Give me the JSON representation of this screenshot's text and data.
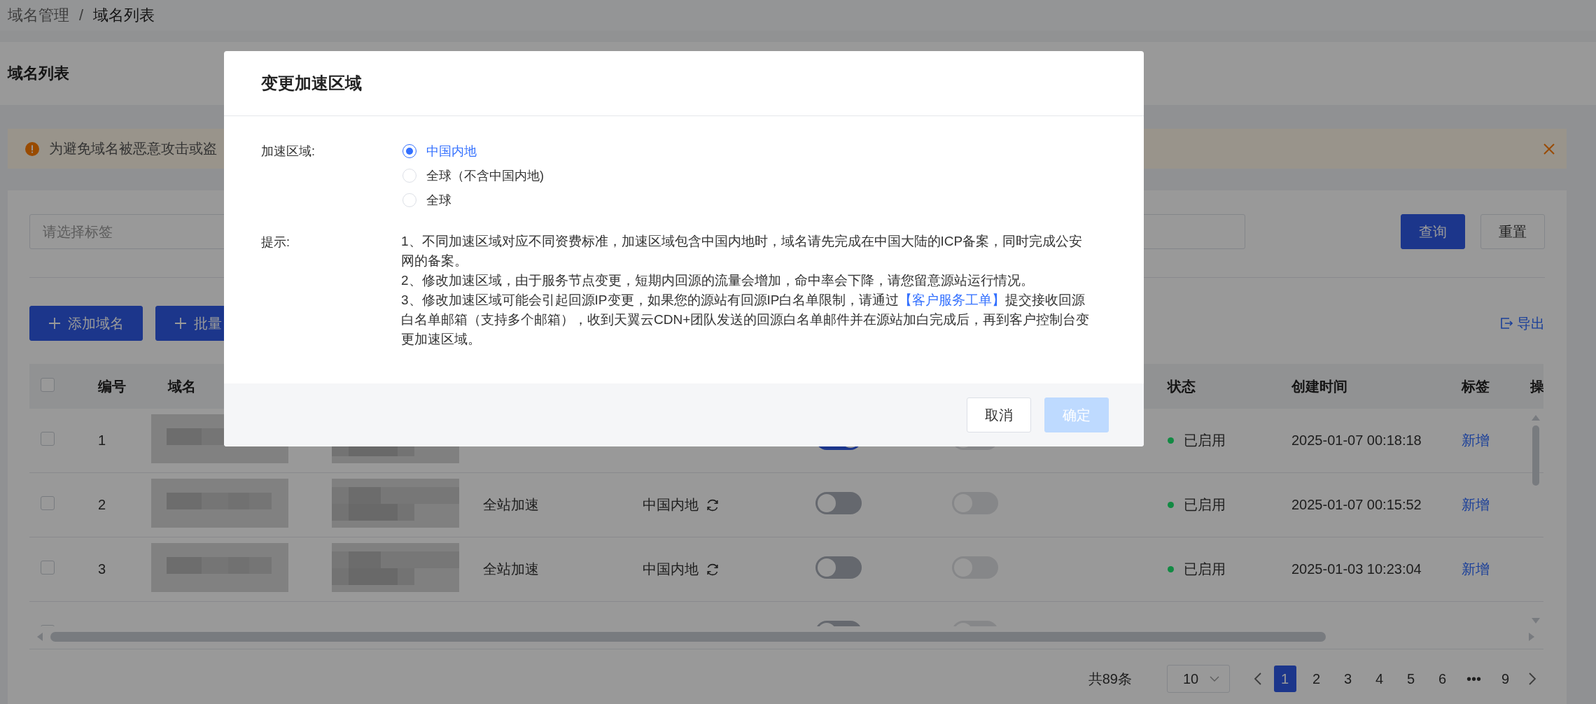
{
  "breadcrumb": {
    "parent": "域名管理",
    "separator": "/",
    "current": "域名列表"
  },
  "page_title": "域名列表",
  "alert": {
    "text": "为避免域名被恶意攻击或盗"
  },
  "filter": {
    "placeholder": "请选择标签"
  },
  "search_button": "查询",
  "reset_button": "重置",
  "actions": [
    {
      "label": "添加域名"
    },
    {
      "label": "批量"
    }
  ],
  "export": "导出",
  "table": {
    "all_checked": false,
    "columns": {
      "number": "编号",
      "domain": "域名",
      "status": "状态",
      "created": "创建时间",
      "tags": "标签",
      "column_12": "操"
    },
    "rows": [
      {
        "checked": false,
        "number": "1",
        "switch_1_on": true,
        "switch_2_on": false,
        "status": "已启用",
        "color": "#128a43",
        "created": "2025-01-07 00:18:18",
        "tag_link": "新增"
      },
      {
        "checked": false,
        "number": "2",
        "type": "全站加速",
        "region": "中国内地",
        "switch_1_on": false,
        "switch_2_on": false,
        "status": "已启用",
        "color": "#128a43",
        "created": "2025-01-07 00:15:52",
        "tag_link": "新增"
      },
      {
        "checked": false,
        "number": "3",
        "type": "全站加速",
        "region": "中国内地",
        "switch_1_on": false,
        "switch_2_on": false,
        "status": "已启用",
        "color": "#128a43",
        "created": "2025-01-03 10:23:04",
        "tag_link": "新增"
      },
      {
        "checked": false,
        "switch_1_on": false,
        "switch_2_on": false
      }
    ]
  },
  "pagination": {
    "total": "共89条",
    "page_size": "10",
    "pages": [
      {
        "label": "1",
        "selected": true
      },
      {
        "label": "2",
        "selected": false
      },
      {
        "label": "3",
        "selected": false
      },
      {
        "label": "4",
        "selected": false
      },
      {
        "label": "5",
        "selected": false
      },
      {
        "label": "6",
        "selected": false
      },
      {
        "label": "•••",
        "selected": false
      },
      {
        "label": "9",
        "selected": false
      }
    ]
  },
  "modal": {
    "title": "变更加速区域",
    "region_label": "加速区域:",
    "options": [
      {
        "label": "中国内地",
        "selected": true
      },
      {
        "label": "全球（不含中国内地)",
        "selected": false
      },
      {
        "label": "全球",
        "selected": false
      }
    ],
    "hint_label": "提示:",
    "hints": [
      {
        "text": "1、不同加速区域对应不同资费标准，加速区域包含中国内地时，域名请先完成在中国大陆的ICP备案，同时完成公安网的备案。"
      },
      {
        "text": "2、修改加速区域，由于服务节点变更，短期内回源的流量会增加，命中率会下降，请您留意源站运行情况。"
      },
      {
        "text": "3、修改加速区域可能会引起回源IP变更，如果您的源站有回源IP白名单限制，请通过",
        "link": "【客户服务工单】",
        "after": "提交接收回源白名单邮箱（支持多个邮箱），收到天翼云CDN+团队发送的回源白名单邮件并在源站加白完成后，再到客户控制台变更加速区域。"
      }
    ],
    "cancel": "取消",
    "confirm": {
      "label": "确定",
      "disabled": true
    }
  }
}
